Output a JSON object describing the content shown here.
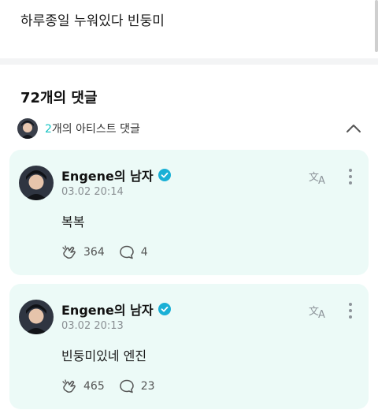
{
  "post": {
    "text": "하루종일 누워있다 빈둥미"
  },
  "comments_header": {
    "count_label": "72개의 댓글"
  },
  "artist_comments": {
    "count": "2",
    "label_suffix": "개의 아티스트 댓글",
    "toggle_icon": "chevron-up-icon"
  },
  "comments": [
    {
      "author": "Engene의 남자",
      "timestamp": "03.02 20:14",
      "text": "복복",
      "likes": "364",
      "replies": "4"
    },
    {
      "author": "Engene의 남자",
      "timestamp": "03.02 20:13",
      "text": "빈둥미있네 엔진",
      "likes": "465",
      "replies": "23"
    }
  ],
  "colors": {
    "card_bg": "#ecfaf7",
    "accent": "#13c2c2",
    "verified": "#1ab0d6"
  }
}
